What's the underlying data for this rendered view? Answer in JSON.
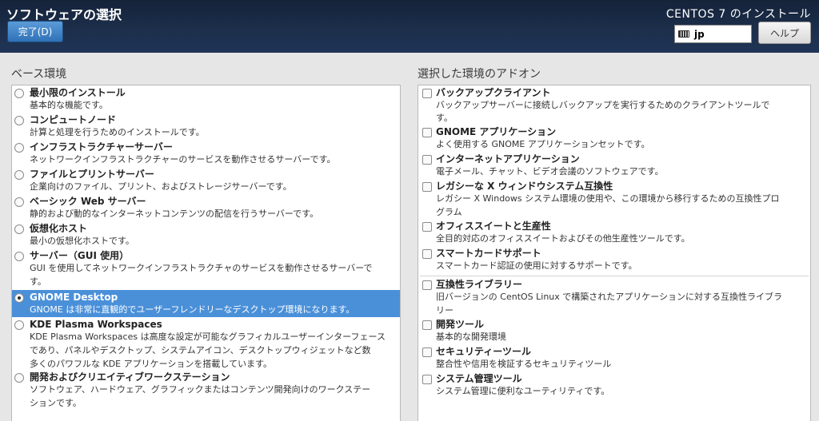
{
  "header": {
    "title": "ソフトウェアの選択",
    "done_label": "完了(D)",
    "product": "CENTOS 7 のインストール",
    "layout": "jp",
    "help_label": "ヘルプ"
  },
  "base": {
    "title": "ベース環境",
    "items": [
      {
        "name": "最小限のインストール",
        "desc": [
          "基本的な機能です。"
        ]
      },
      {
        "name": "コンピュートノード",
        "desc": [
          "計算と処理を行うためのインストールです。"
        ]
      },
      {
        "name": "インフラストラクチャーサーバー",
        "desc": [
          "ネットワークインフラストラクチャーのサービスを動作させるサーバーです。"
        ]
      },
      {
        "name": "ファイルとプリントサーバー",
        "desc": [
          "企業向けのファイル、プリント、およびストレージサーバーです。"
        ]
      },
      {
        "name": "ベーシック Web サーバー",
        "desc": [
          "静的および動的なインターネットコンテンツの配信を行うサーバーです。"
        ]
      },
      {
        "name": "仮想化ホスト",
        "desc": [
          "最小の仮想化ホストです。"
        ]
      },
      {
        "name": "サーバー（GUI 使用）",
        "desc": [
          "GUI を使用してネットワークインフラストラクチャのサービスを動作させるサーバーで",
          "す。"
        ]
      },
      {
        "name": "GNOME Desktop",
        "desc": [
          "GNOME は非常に直観的でユーザーフレンドリーなデスクトップ環境になります。"
        ]
      },
      {
        "name": "KDE Plasma Workspaces",
        "desc": [
          "KDE Plasma Workspaces は高度な設定が可能なグラフィカルユーザーインターフェース",
          "であり、パネルやデスクトップ、システムアイコン、デスクトップウィジェットなど数",
          "多くのパワフルな KDE アプリケーションを搭載しています。"
        ]
      },
      {
        "name": "開発およびクリエイティブワークステーション",
        "desc": [
          "ソフトウェア、ハードウェア、グラフィックまたはコンテンツ開発向けのワークステー",
          "ションです。"
        ]
      }
    ]
  },
  "addons": {
    "title": "選択した環境のアドオン",
    "items": [
      {
        "name": "バックアップクライアント",
        "desc": [
          "バックアップサーバーに接続しバックアップを実行するためのクライアントツールで",
          "す。"
        ]
      },
      {
        "name": "GNOME アプリケーション",
        "desc": [
          "よく使用する GNOME アプリケーションセットです。"
        ]
      },
      {
        "name": "インターネットアプリケーション",
        "desc": [
          "電子メール、チャット、ビデオ会議のソフトウェアです。"
        ]
      },
      {
        "name": "レガシーな X ウィンドウシステム互換性",
        "desc": [
          "レガシー X Windows システム環境の使用や、この環境から移行するための互換性プロ",
          "グラム"
        ]
      },
      {
        "name": "オフィススイートと生産性",
        "desc": [
          "全目的対応のオフィススイートおよびその他生産性ツールです。"
        ]
      },
      {
        "name": "スマートカードサポート",
        "desc": [
          "スマートカード認証の使用に対するサポートです。"
        ]
      },
      {
        "name": "互換性ライブラリー",
        "desc": [
          "旧バージョンの CentOS Linux で構築されたアプリケーションに対する互換性ライブラ",
          "リー"
        ]
      },
      {
        "name": "開発ツール",
        "desc": [
          "基本的な開発環境"
        ]
      },
      {
        "name": "セキュリティーツール",
        "desc": [
          "整合性や信用を検証するセキュリティツール"
        ]
      },
      {
        "name": "システム管理ツール",
        "desc": [
          "システム管理に便利なユーティリティです。"
        ]
      }
    ]
  }
}
